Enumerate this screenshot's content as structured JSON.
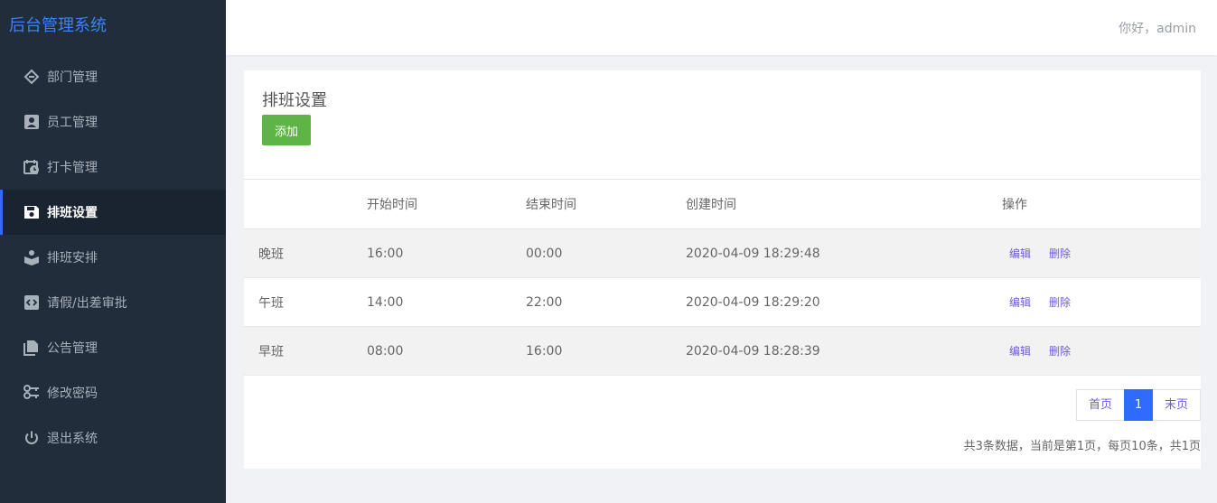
{
  "sidebar": {
    "brand": "后台管理系统",
    "items": [
      {
        "label": "部门管理",
        "icon": "dept-icon"
      },
      {
        "label": "员工管理",
        "icon": "employee-icon"
      },
      {
        "label": "打卡管理",
        "icon": "clock-in-icon"
      },
      {
        "label": "排班设置",
        "icon": "save-icon",
        "active": true
      },
      {
        "label": "排班安排",
        "icon": "box-icon"
      },
      {
        "label": "请假/出差审批",
        "icon": "code-icon"
      },
      {
        "label": "公告管理",
        "icon": "document-icon"
      },
      {
        "label": "修改密码",
        "icon": "key-icon"
      },
      {
        "label": "退出系统",
        "icon": "power-icon"
      }
    ]
  },
  "header": {
    "greeting": "你好，admin"
  },
  "main": {
    "title": "排班设置",
    "add_label": "添加",
    "columns": [
      "",
      "开始时间",
      "结束时间",
      "创建时间",
      "操作"
    ],
    "rows": [
      {
        "name": "晚班",
        "start": "16:00",
        "end": "00:00",
        "created": "2020-04-09 18:29:48"
      },
      {
        "name": "午班",
        "start": "14:00",
        "end": "22:00",
        "created": "2020-04-09 18:29:20"
      },
      {
        "name": "早班",
        "start": "08:00",
        "end": "16:00",
        "created": "2020-04-09 18:28:39"
      }
    ],
    "actions": {
      "edit": "编辑",
      "delete": "删除"
    },
    "pager": {
      "first": "首页",
      "current": "1",
      "last": "末页"
    },
    "summary": "共3条数据，当前是第1页，每页10条，共1页"
  },
  "colors": {
    "sidebar_bg": "#222d3c",
    "accent": "#2f6bff",
    "add_button": "#5fb446",
    "link": "#6f5bd6"
  }
}
